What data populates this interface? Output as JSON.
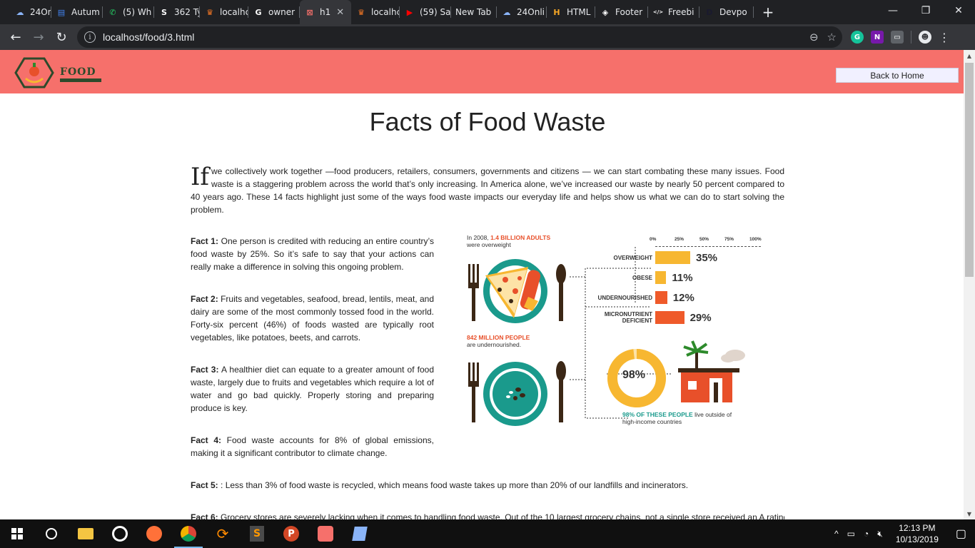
{
  "browser": {
    "tabs": [
      {
        "label": "24Onli",
        "icon": "cloud",
        "color": "#8ab4f8"
      },
      {
        "label": "Autum",
        "icon": "doc",
        "color": "#4285f4"
      },
      {
        "label": "(5) Wh",
        "icon": "whatsapp",
        "color": "#25d366"
      },
      {
        "label": "362 Ty",
        "icon": "s-logo",
        "color": "#ffffff"
      },
      {
        "label": "localhc",
        "icon": "xampp-crown",
        "color": "#fb7a24"
      },
      {
        "label": "owner",
        "icon": "google",
        "color": "#ffffff"
      },
      {
        "label": "h1",
        "icon": "codesandbox",
        "color": "#f6706b",
        "active": true
      },
      {
        "label": "localhc",
        "icon": "xampp-crown",
        "color": "#fb7a24"
      },
      {
        "label": "(59) Sa",
        "icon": "youtube",
        "color": "#ff0000"
      },
      {
        "label": "New Tab",
        "icon": "",
        "color": ""
      },
      {
        "label": "24Onli",
        "icon": "cloud",
        "color": "#8ab4f8"
      },
      {
        "label": "HTML",
        "icon": "html-box",
        "color": "#f9a825"
      },
      {
        "label": "Footer",
        "icon": "codepen",
        "color": "#ffffff"
      },
      {
        "label": "Freebi",
        "icon": "code-box",
        "color": "#ffffff"
      },
      {
        "label": "Devpo",
        "icon": "d-logo",
        "color": "#1a1a2e"
      }
    ],
    "url": "localhost/food/3.html",
    "close_tab": "✕",
    "new_tab": "+"
  },
  "site": {
    "logo_text": "FOOD",
    "back_button": "Back to Home",
    "accent": "#f6706b"
  },
  "article": {
    "title": "Facts of Food Waste",
    "intro_dropcap": "If",
    "intro": "we collectively work together —food producers, retailers, consumers, governments and citizens — we can start combating these many issues. Food waste is a staggering problem across the world that’s only increasing. In America alone, we’ve increased our waste by nearly 50 percent compared to 40 years ago. These 14 facts highlight just some of the ways food waste impacts our everyday life and helps show us what we can do to start solving the problem.",
    "facts": [
      {
        "label": "Fact 1:",
        "text": "One person is credited with reducing an entire country’s food waste by 25%. So it’s safe to say that your actions can really make a difference in solving this ongoing problem."
      },
      {
        "label": "Fact 2:",
        "text": "Fruits and vegetables, seafood, bread, lentils, meat, and dairy are some of the most commonly tossed food in the world. Forty-six percent (46%) of foods wasted are typically root vegetables, like potatoes, beets, and carrots."
      },
      {
        "label": "Fact 3:",
        "text": "A healthier diet can equate to a greater amount of food waste, largely due to fruits and vegetables which require a lot of water and go bad quickly. Properly storing and preparing produce is key."
      },
      {
        "label": "Fact 4:",
        "text": "Food waste accounts for 8% of global emissions, making it a significant contributor to climate change."
      },
      {
        "label": "Fact 5:",
        "text": ": Less than 3% of food waste is recycled, which means food waste takes up more than 20% of our landfills and incinerators."
      },
      {
        "label": "Fact 6:",
        "text": "Grocery stores are severely lacking when it comes to handling food waste. Out of the 10 largest grocery chains, not a single store received an A rating"
      }
    ]
  },
  "infographic": {
    "top_pre": "In 2008,",
    "top_highlight": "1.4 BILLION ADULTS",
    "top_post": "were overweight",
    "axis_ticks": [
      "0%",
      "25%",
      "50%",
      "75%",
      "100%"
    ],
    "bars": [
      {
        "label": "OVERWEIGHT",
        "value": 35,
        "display": "35%",
        "color": "#f7b731"
      },
      {
        "label": "OBESE",
        "value": 11,
        "display": "11%",
        "color": "#f7b731"
      },
      {
        "label": "UNDERNOURISHED",
        "value": 12,
        "display": "12%",
        "color": "#ef5a2a"
      },
      {
        "label": "MICRONUTRIENT DEFICIENT",
        "value": 29,
        "display": "29%",
        "color": "#ef5a2a"
      }
    ],
    "mid_highlight": "842 MILLION PEOPLE",
    "mid_post": "are undernourished.",
    "donut_value": 98,
    "donut_display": "98%",
    "bottom_highlight": "98% OF THESE PEOPLE",
    "bottom_post": "live outside of",
    "bottom_line2": "high-income countries"
  },
  "taskbar": {
    "time": "12:13 PM",
    "date": "10/13/2019"
  }
}
